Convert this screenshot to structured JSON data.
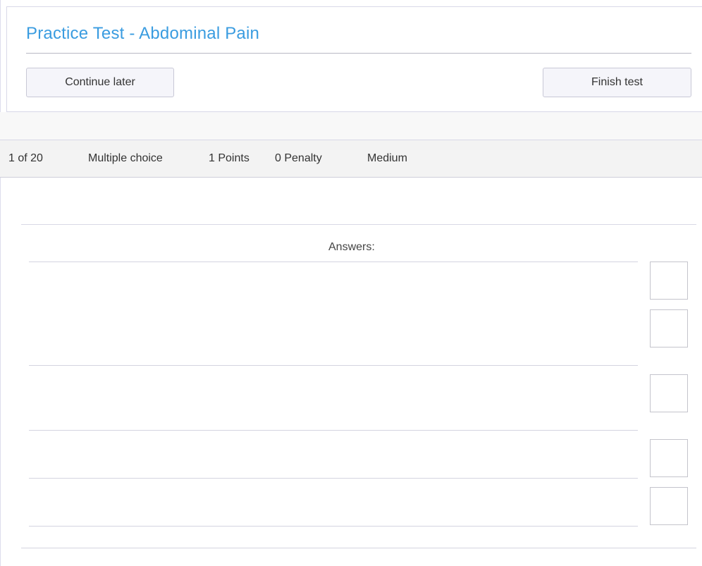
{
  "test": {
    "title": "Practice Test - Abdominal Pain"
  },
  "actions": {
    "continue_label": "Continue later",
    "finish_label": "Finish test"
  },
  "question": {
    "position": "1 of 20",
    "type": "Multiple choice",
    "points": "1 Points",
    "penalty": "0 Penalty",
    "difficulty": "Medium",
    "text": ""
  },
  "answers": {
    "label": "Answers:",
    "options": [
      {
        "text": "",
        "checked": false
      },
      {
        "text": "",
        "checked": false
      },
      {
        "text": "",
        "checked": false
      },
      {
        "text": "",
        "checked": false
      },
      {
        "text": "",
        "checked": false
      }
    ]
  },
  "colors": {
    "title": "#3a9ce0",
    "button_bg": "#f5f5fa",
    "info_bar_bg": "#f3f3f3"
  }
}
